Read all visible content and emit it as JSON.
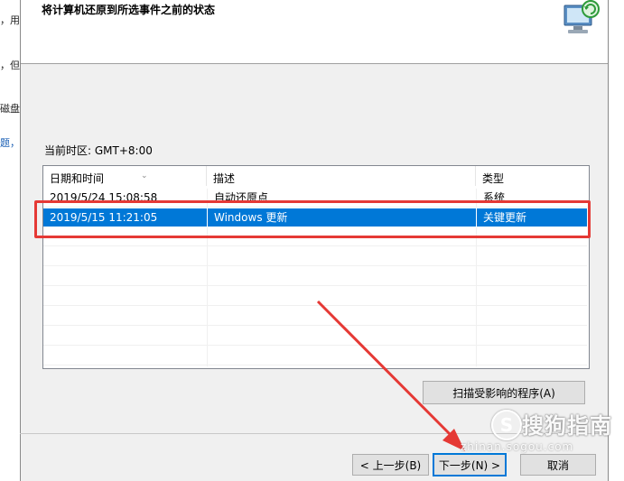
{
  "background_window": {
    "fragments": [
      "，用",
      "，但",
      "磁盘",
      "题，"
    ]
  },
  "dialog": {
    "title": "将计算机还原到所选事件之前的状态",
    "icon": "system-restore-icon",
    "timezone_label": "当前时区: GMT+8:00",
    "list": {
      "columns": [
        "日期和时间",
        "描述",
        "类型"
      ],
      "rows": [
        {
          "date": "2019/5/24 15:08:58",
          "description": "自动还原点",
          "type": "系统",
          "selected": false
        },
        {
          "date": "2019/5/15 11:21:05",
          "description": "Windows 更新",
          "type": "关键更新",
          "selected": true
        }
      ]
    },
    "scan_button": "扫描受影响的程序(A)",
    "back_button": "< 上一步(B)",
    "next_button": "下一步(N) >",
    "cancel_button": "取消"
  },
  "annotation": {
    "highlight_color": "#e53935",
    "arrow_color": "#e53935"
  },
  "watermark": {
    "text": "搜狗指南",
    "sub": "zhinan.sogou.com",
    "logo": "S"
  },
  "colors": {
    "selection": "#0078d7",
    "dialog_bg": "#f0f0f0"
  }
}
